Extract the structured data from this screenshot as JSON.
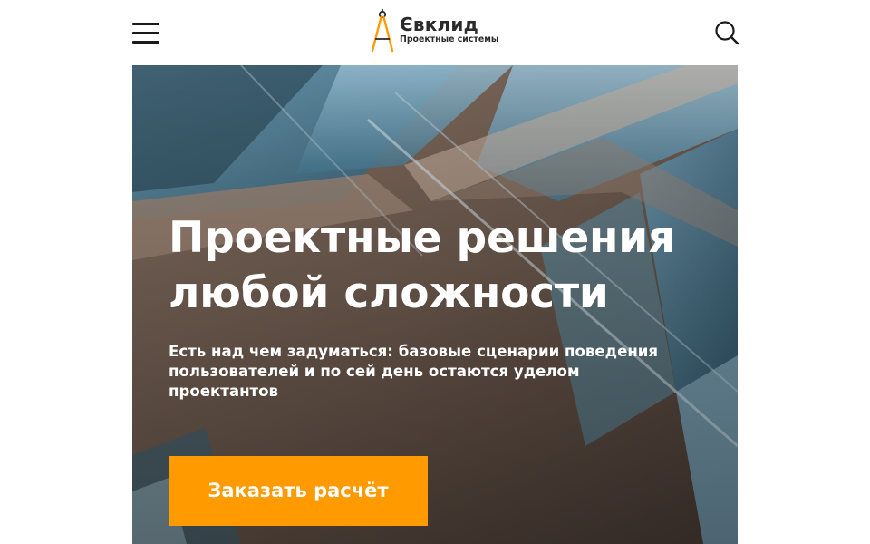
{
  "header": {
    "menu_icon": "hamburger-menu-icon",
    "logo": {
      "title": "Євклид",
      "subtitle": "Проектные системы",
      "mark_icon": "compass-drafting-icon"
    },
    "search_icon": "search-icon"
  },
  "hero": {
    "title_line1": "Проектные решения",
    "title_line2": "любой сложности",
    "description": "Есть над чем задуматься: базовые сценарии поведения пользователей и по сей день остаются уделом проектантов",
    "cta_label": "Заказать расчёт"
  },
  "colors": {
    "accent": "#ff9a00",
    "text_dark": "#2b2b2b",
    "hero_text": "#ffffff"
  }
}
